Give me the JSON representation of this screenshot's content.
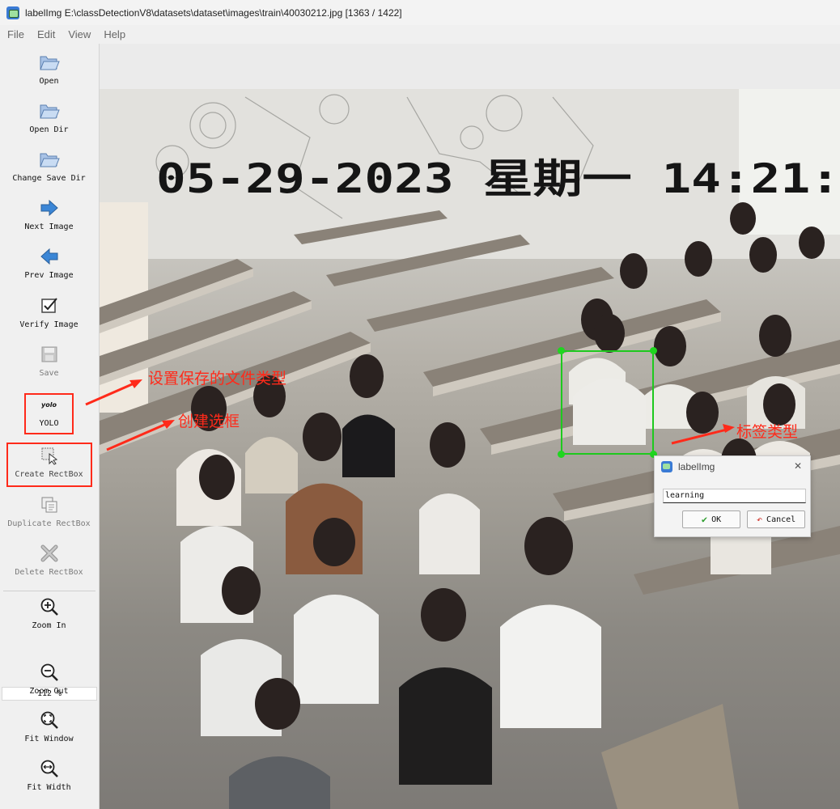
{
  "window": {
    "title": "labelImg E:\\classDetectionV8\\datasets\\dataset\\images\\train\\40030212.jpg [1363 / 1422]"
  },
  "menu": [
    "File",
    "Edit",
    "View",
    "Help"
  ],
  "toolbar": {
    "open": "Open",
    "open_dir": "Open Dir",
    "change_save_dir": "Change Save Dir",
    "next_image": "Next Image",
    "prev_image": "Prev Image",
    "verify_image": "Verify Image",
    "save": "Save",
    "format_icon_text": "yolo",
    "format": "YOLO",
    "create_rectbox": "Create RectBox",
    "duplicate_rectbox": "Duplicate RectBox",
    "delete_rectbox": "Delete RectBox",
    "zoom_in": "Zoom In",
    "zoom_level": "112 %",
    "zoom_out": "Zoom Out",
    "fit_window": "Fit Window",
    "fit_width": "Fit Width"
  },
  "image": {
    "timestamp_overlay": "05-29-2023 星期一 14:21:"
  },
  "label_dialog": {
    "title": "labelImg",
    "input_value": "learning",
    "ok": "OK",
    "cancel": "Cancel"
  },
  "annotations": {
    "save_format": "设置保存的文件类型",
    "create_box": "创建选框",
    "label_type": "标签类型"
  },
  "colors": {
    "annotation_red": "#ff2a1a",
    "bbox_green": "#1ec91e",
    "arrow_blue": "#3b86d6"
  }
}
